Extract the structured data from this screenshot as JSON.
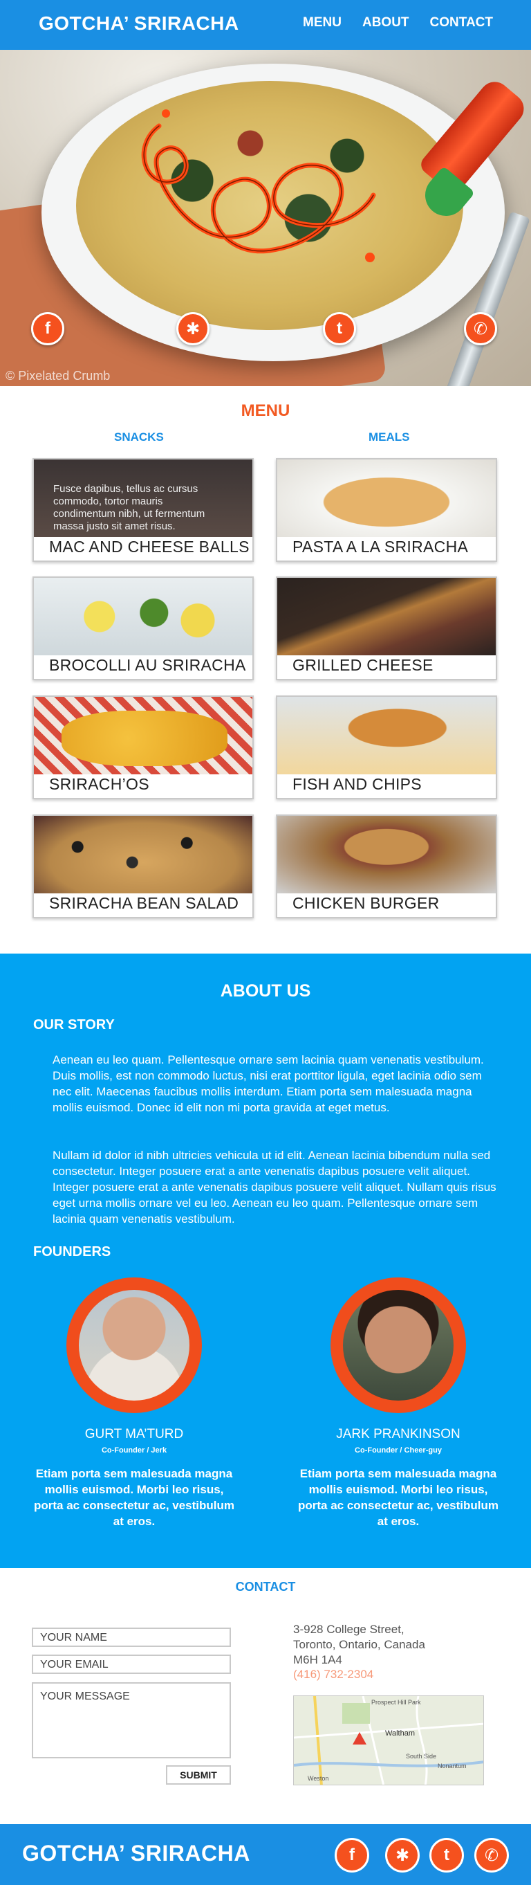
{
  "header": {
    "brand": "GOTCHA’ SRIRACHA",
    "nav": [
      "MENU",
      "ABOUT",
      "CONTACT"
    ]
  },
  "hero": {
    "watermark": "© Pixelated Crumb",
    "social_icons": [
      "facebook-icon",
      "yelp-icon",
      "twitter-icon",
      "phone-icon"
    ]
  },
  "menu": {
    "title": "MENU",
    "snacks_heading": "SNACKS",
    "meals_heading": "MEALS",
    "snacks": [
      "MAC AND CHEESE BALLS",
      "BROCOLLI AU SRIRACHA",
      "SRIRACH’OS",
      "SRIRACHA BEAN SALAD"
    ],
    "meals": [
      "PASTA A LA SRIRACHA",
      "GRILLED CHEESE",
      "FISH AND CHIPS",
      "CHICKEN BURGER"
    ],
    "hover_text": "Fusce dapibus, tellus ac cursus commodo, tortor mauris condimentum nibh, ut fermentum massa justo sit amet risus."
  },
  "about": {
    "title": "ABOUT US",
    "story_heading": "OUR STORY",
    "story_p1": "Aenean eu leo quam. Pellentesque ornare sem lacinia quam venenatis vestibulum. Duis mollis, est non commodo luctus, nisi erat porttitor ligula, eget lacinia odio sem nec elit. Maecenas faucibus mollis interdum. Etiam porta sem malesuada magna mollis euismod. Donec id elit non mi porta gravida at eget metus.",
    "story_p2": "Nullam id dolor id nibh ultricies vehicula ut id elit. Aenean lacinia bibendum nulla sed consectetur. Integer posuere erat a ante venenatis dapibus posuere velit aliquet. Integer posuere erat a ante venenatis dapibus posuere velit aliquet. Nullam quis risus eget urna mollis ornare vel eu leo. Aenean eu leo quam. Pellentesque ornare sem lacinia quam venenatis vestibulum.",
    "founders_heading": "FOUNDERS",
    "founders": [
      {
        "name": "GURT MA’TURD",
        "role": "Co-Founder / Jerk",
        "bio": "Etiam porta sem malesuada magna mollis euismod. Morbi leo risus, porta ac consectetur ac, vestibulum at eros."
      },
      {
        "name": "JARK PRANKINSON",
        "role": "Co-Founder / Cheer-guy",
        "bio": "Etiam porta sem malesuada magna mollis euismod. Morbi leo risus, porta ac consectetur ac, vestibulum at eros."
      }
    ]
  },
  "contact": {
    "title": "CONTACT",
    "name_placeholder": "YOUR NAME",
    "email_placeholder": "YOUR EMAIL",
    "message_placeholder": "YOUR MESSAGE",
    "submit": "SUBMIT",
    "address_line1": "3-928 College Street,",
    "address_line2": "Toronto, Ontario, Canada",
    "address_line3": "M6H 1A4",
    "phone": "(416) 732-2304",
    "map_labels": [
      "Prospect Hill Park",
      "Waltham",
      "South Side",
      "Nonantum",
      "Weston"
    ]
  },
  "footer": {
    "brand": "GOTCHA’ SRIRACHA",
    "social_icons": [
      "facebook-icon",
      "yelp-icon",
      "twitter-icon",
      "phone-icon"
    ]
  },
  "colors": {
    "primary_blue": "#1a8fe3",
    "about_blue": "#02a3f2",
    "accent_orange": "#f25a22"
  }
}
